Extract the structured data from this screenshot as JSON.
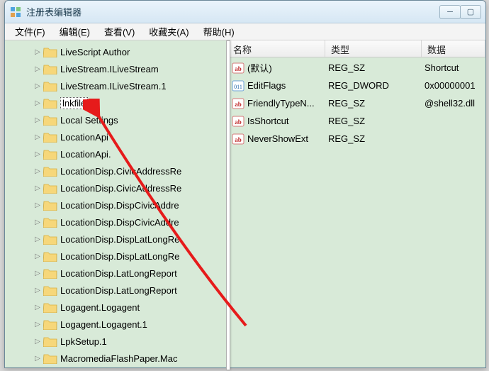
{
  "window": {
    "title": "注册表编辑器"
  },
  "menu": {
    "file": "文件(F)",
    "edit": "编辑(E)",
    "view": "查看(V)",
    "favorites": "收藏夹(A)",
    "help": "帮助(H)"
  },
  "tree": {
    "items": [
      {
        "label": "LiveScript Author"
      },
      {
        "label": "LiveStream.ILiveStream"
      },
      {
        "label": "LiveStream.ILiveStream.1"
      },
      {
        "label": "lnkfile",
        "selected": true
      },
      {
        "label": "Local Settings"
      },
      {
        "label": "LocationApi"
      },
      {
        "label": "LocationApi."
      },
      {
        "label": "LocationDisp.CivicAddressRe"
      },
      {
        "label": "LocationDisp.CivicAddressRe"
      },
      {
        "label": "LocationDisp.DispCivicAddre"
      },
      {
        "label": "LocationDisp.DispCivicAddre"
      },
      {
        "label": "LocationDisp.DispLatLongRe"
      },
      {
        "label": "LocationDisp.DispLatLongRe"
      },
      {
        "label": "LocationDisp.LatLongReport"
      },
      {
        "label": "LocationDisp.LatLongReport"
      },
      {
        "label": "Logagent.Logagent"
      },
      {
        "label": "Logagent.Logagent.1"
      },
      {
        "label": "LpkSetup.1"
      },
      {
        "label": "MacromediaFlashPaper.Mac"
      }
    ]
  },
  "list": {
    "headers": {
      "name": "名称",
      "type": "类型",
      "data": "数据"
    },
    "rows": [
      {
        "kind": "str",
        "name": "(默认)",
        "type": "REG_SZ",
        "data": "Shortcut"
      },
      {
        "kind": "bin",
        "name": "EditFlags",
        "type": "REG_DWORD",
        "data": "0x00000001"
      },
      {
        "kind": "str",
        "name": "FriendlyTypeN...",
        "type": "REG_SZ",
        "data": "@shell32.dll"
      },
      {
        "kind": "str",
        "name": "IsShortcut",
        "type": "REG_SZ",
        "data": ""
      },
      {
        "kind": "str",
        "name": "NeverShowExt",
        "type": "REG_SZ",
        "data": ""
      }
    ]
  }
}
